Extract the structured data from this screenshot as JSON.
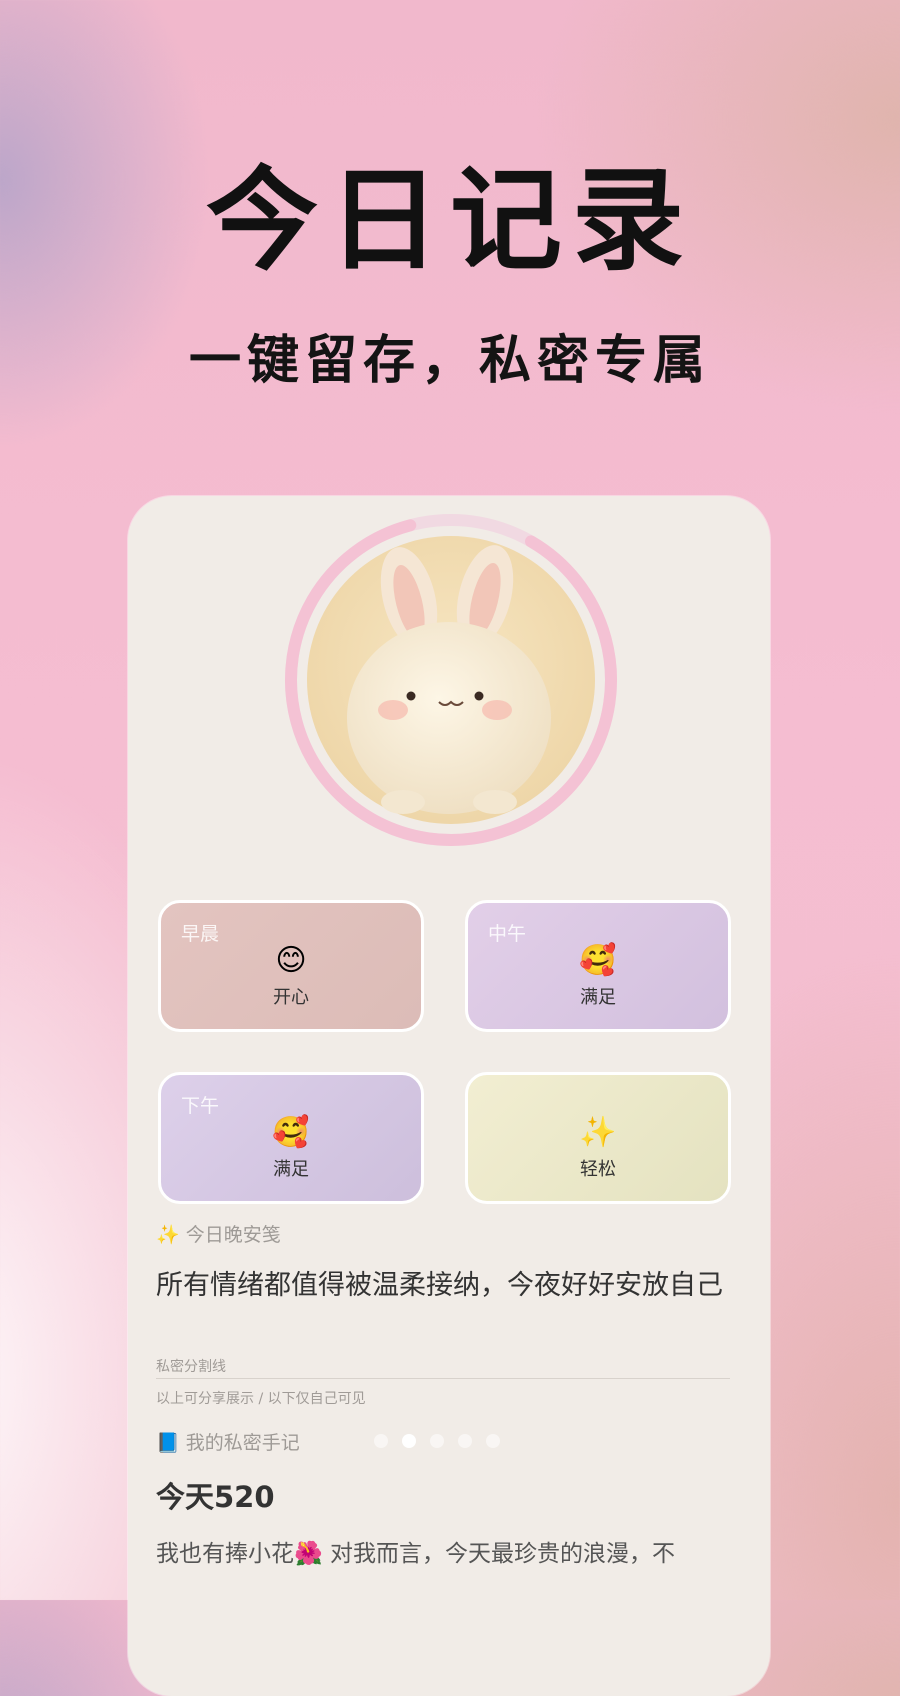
{
  "hero": {
    "title": "今日记录",
    "subtitle": "一键留存，私密专属"
  },
  "mood_cards": [
    {
      "period": "早晨",
      "emoji": "😊",
      "mood": "开心"
    },
    {
      "period": "中午",
      "emoji": "🥰",
      "mood": "满足"
    },
    {
      "period": "下午",
      "emoji": "🥰",
      "mood": "满足"
    },
    {
      "period": "",
      "emoji": "✨",
      "mood": "轻松"
    }
  ],
  "night_note": {
    "icon": "✨",
    "label": "今日晚安笺",
    "text": "所有情绪都值得被温柔接纳，今夜好好安放自己"
  },
  "divider": {
    "label": "私密分割线",
    "note": "以上可分享展示 / 以下仅自己可见"
  },
  "diary": {
    "icon": "📘",
    "label": "我的私密手记",
    "title": "今天520",
    "body": "我也有捧小花🌺 对我而言，今天最珍贵的浪漫，不"
  },
  "pager": {
    "count": 5,
    "active": 1
  },
  "colors": {
    "ring": "#f4c2d4",
    "card_border": "#ffffff",
    "panel": "#f1ece7"
  }
}
